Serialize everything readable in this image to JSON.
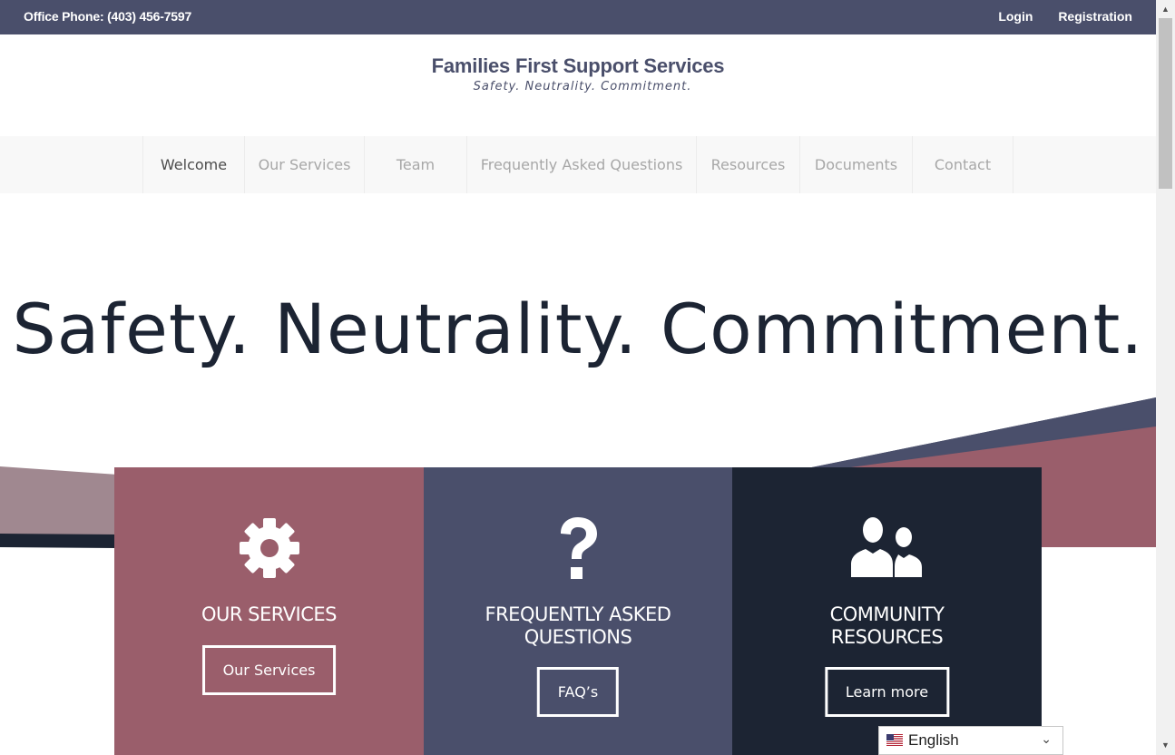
{
  "topbar": {
    "phone": "Office Phone: (403) 456-7597",
    "login": "Login",
    "registration": "Registration"
  },
  "logo": {
    "name": "Families First Support Services",
    "tagline": "Safety. Neutrality. Commitment."
  },
  "nav": {
    "items": [
      {
        "label": "Welcome",
        "active": true
      },
      {
        "label": "Our Services"
      },
      {
        "label": "Team"
      },
      {
        "label": "Frequently Asked Questions"
      },
      {
        "label": "Resources"
      },
      {
        "label": "Documents"
      },
      {
        "label": "Contact"
      }
    ]
  },
  "hero": {
    "title": "Safety. Neutrality. Commitment."
  },
  "cards": [
    {
      "icon": "gear-icon",
      "title": "OUR SERVICES",
      "button": "Our Services",
      "color": "#9a5e6b"
    },
    {
      "icon": "question-mark-icon",
      "title_line1": "FREQUENTLY ASKED",
      "title_line2": "QUESTIONS",
      "button": "FAQ’s",
      "color": "#4a4f6b"
    },
    {
      "icon": "people-icon",
      "title_line1": "COMMUNITY",
      "title_line2": "RESOURCES",
      "button": "Learn more",
      "color": "#1c2433"
    }
  ],
  "language": {
    "selected": "English",
    "flag": "us-flag-icon"
  },
  "colors": {
    "topbar": "#4a4f6b",
    "rose": "#9a5e6b",
    "slate": "#4a4f6b",
    "navy": "#1c2433"
  }
}
